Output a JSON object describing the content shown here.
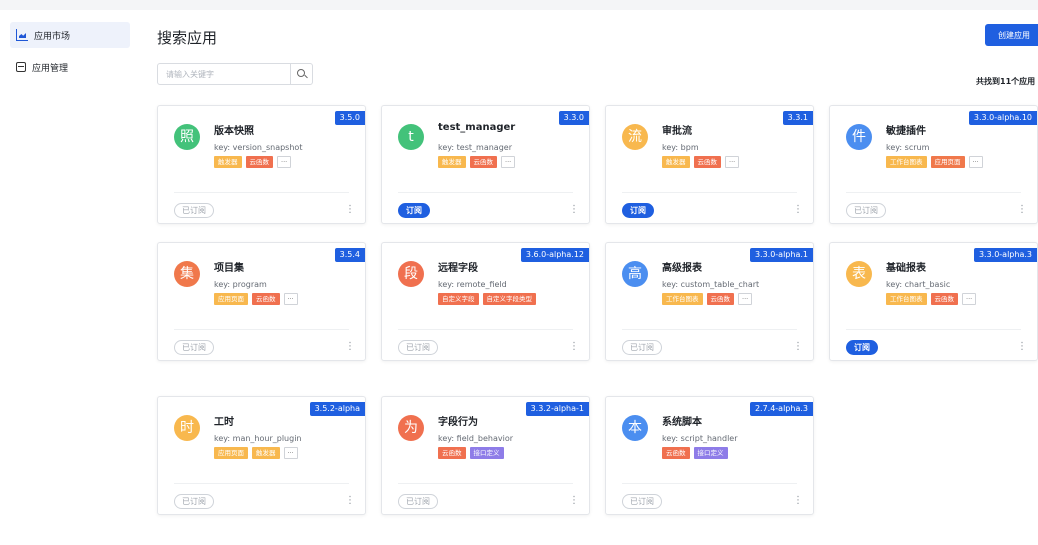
{
  "sidebar": {
    "items": [
      {
        "label": "应用市场",
        "icon": "chart-icon",
        "active": true
      },
      {
        "label": "应用管理",
        "icon": "box-icon",
        "active": false
      }
    ]
  },
  "header": {
    "title": "搜索应用",
    "create_label": "创建应用",
    "search_placeholder": "请输入关键字",
    "found_text": "共找到11个应用"
  },
  "colors": {
    "accent": "#1f5fe0",
    "tag_orange": "#f0784b",
    "tag_yellow": "#f8b84e",
    "tag_red": "#f0704f",
    "tag_purple": "#8e7ce8"
  },
  "cards": [
    {
      "avatar": "照",
      "avatar_color": "#43c27a",
      "name": "版本快照",
      "key": "key: version_snapshot",
      "version": "3.5.0",
      "tags": [
        {
          "label": "触发器",
          "color": "#f8b84e"
        },
        {
          "label": "云函数",
          "color": "#f0704f"
        }
      ],
      "more": true,
      "subscribe": "已订阅",
      "subscribed": true
    },
    {
      "avatar": "t",
      "avatar_color": "#43c27a",
      "name": "test_manager",
      "key": "key: test_manager",
      "version": "3.3.0",
      "tags": [
        {
          "label": "触发器",
          "color": "#f8b84e"
        },
        {
          "label": "云函数",
          "color": "#f0704f"
        }
      ],
      "more": true,
      "subscribe": "订阅",
      "subscribed": false
    },
    {
      "avatar": "流",
      "avatar_color": "#f8b84e",
      "name": "审批流",
      "key": "key: bpm",
      "version": "3.3.1",
      "tags": [
        {
          "label": "触发器",
          "color": "#f8b84e"
        },
        {
          "label": "云函数",
          "color": "#f0704f"
        }
      ],
      "more": true,
      "subscribe": "订阅",
      "subscribed": false
    },
    {
      "avatar": "件",
      "avatar_color": "#4b8ef0",
      "name": "敏捷插件",
      "key": "key: scrum",
      "version": "3.3.0-alpha.10",
      "tags": [
        {
          "label": "工作台图表",
          "color": "#f8b84e"
        },
        {
          "label": "应用页面",
          "color": "#f0784b"
        }
      ],
      "more": true,
      "subscribe": "已订阅",
      "subscribed": true
    },
    {
      "avatar": "集",
      "avatar_color": "#f0784b",
      "name": "项目集",
      "key": "key: program",
      "version": "3.5.4",
      "tags": [
        {
          "label": "应用页面",
          "color": "#f8b84e"
        },
        {
          "label": "云函数",
          "color": "#f0704f"
        }
      ],
      "more": true,
      "subscribe": "已订阅",
      "subscribed": true
    },
    {
      "avatar": "段",
      "avatar_color": "#f0704f",
      "name": "远程字段",
      "key": "key: remote_field",
      "version": "3.6.0-alpha.12",
      "tags": [
        {
          "label": "自定义字段",
          "color": "#f0704f"
        },
        {
          "label": "自定义字段类型",
          "color": "#f0704f"
        }
      ],
      "more": false,
      "subscribe": "已订阅",
      "subscribed": true
    },
    {
      "avatar": "高",
      "avatar_color": "#4b8ef0",
      "name": "高级报表",
      "key": "key: custom_table_chart",
      "version": "3.3.0-alpha.1",
      "tags": [
        {
          "label": "工作台图表",
          "color": "#f8b84e"
        },
        {
          "label": "云函数",
          "color": "#f0704f"
        }
      ],
      "more": true,
      "subscribe": "已订阅",
      "subscribed": true
    },
    {
      "avatar": "表",
      "avatar_color": "#f8b84e",
      "name": "基础报表",
      "key": "key: chart_basic",
      "version": "3.3.0-alpha.3",
      "tags": [
        {
          "label": "工作台图表",
          "color": "#f8b84e"
        },
        {
          "label": "云函数",
          "color": "#f0704f"
        }
      ],
      "more": true,
      "subscribe": "订阅",
      "subscribed": false
    },
    {
      "avatar": "时",
      "avatar_color": "#f8b84e",
      "name": "工时",
      "key": "key: man_hour_plugin",
      "version": "3.5.2-alpha",
      "tags": [
        {
          "label": "应用页面",
          "color": "#f8b84e"
        },
        {
          "label": "触发器",
          "color": "#f8b84e"
        }
      ],
      "more": true,
      "subscribe": "已订阅",
      "subscribed": true
    },
    {
      "avatar": "为",
      "avatar_color": "#f0704f",
      "name": "字段行为",
      "key": "key: field_behavior",
      "version": "3.3.2-alpha-1",
      "tags": [
        {
          "label": "云函数",
          "color": "#f0704f"
        },
        {
          "label": "接口定义",
          "color": "#8e7ce8"
        }
      ],
      "more": false,
      "subscribe": "已订阅",
      "subscribed": true
    },
    {
      "avatar": "本",
      "avatar_color": "#4b8ef0",
      "name": "系统脚本",
      "key": "key: script_handler",
      "version": "2.7.4-alpha.3",
      "tags": [
        {
          "label": "云函数",
          "color": "#f0704f"
        },
        {
          "label": "接口定义",
          "color": "#8e7ce8"
        }
      ],
      "more": false,
      "subscribe": "已订阅",
      "subscribed": true
    }
  ]
}
